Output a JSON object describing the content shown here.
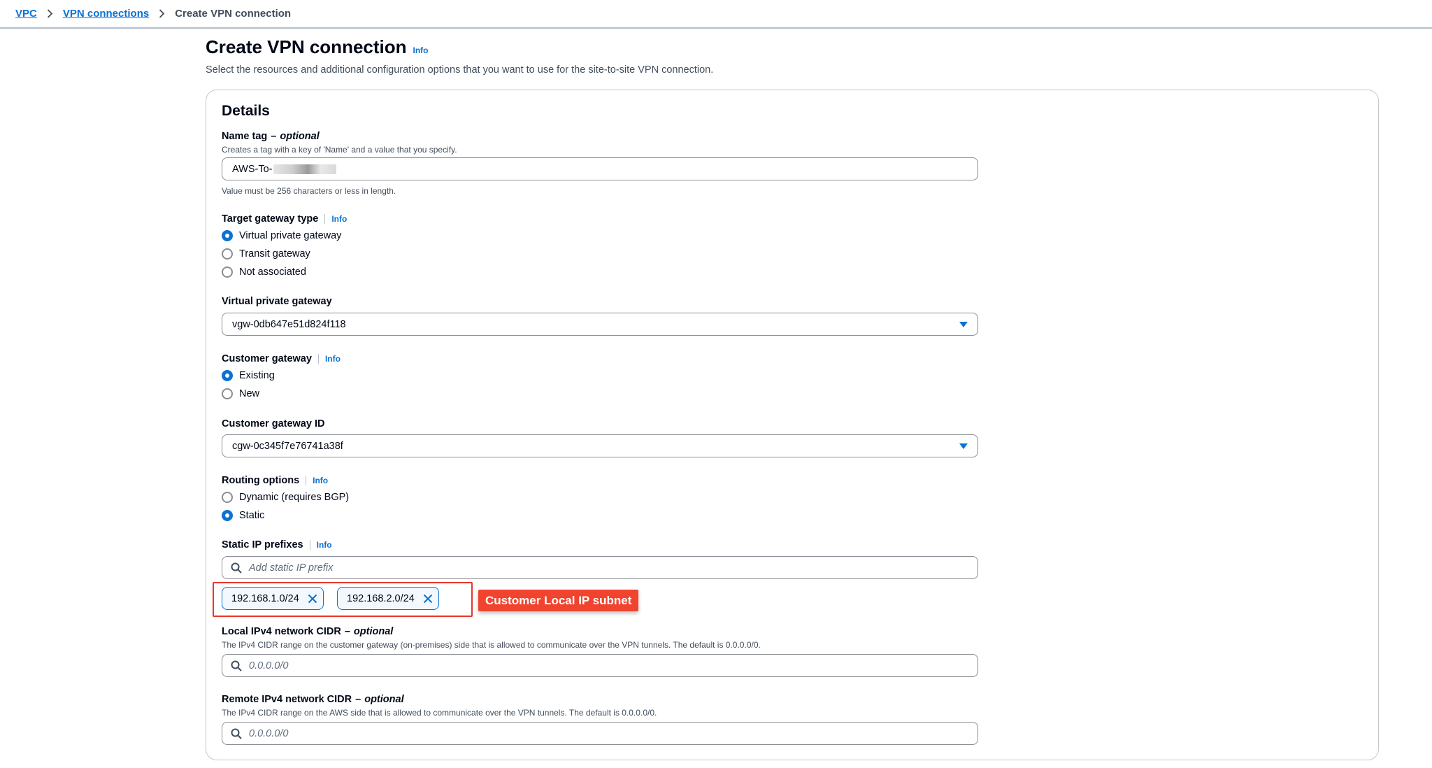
{
  "breadcrumb": {
    "items": [
      "VPC",
      "VPN connections"
    ],
    "current": "Create VPN connection"
  },
  "header": {
    "title": "Create VPN connection",
    "info": "Info",
    "description": "Select the resources and additional configuration options that you want to use for the site-to-site VPN connection."
  },
  "details": {
    "title": "Details",
    "name_tag": {
      "label": "Name tag",
      "optional": "optional",
      "description": "Creates a tag with a key of 'Name' and a value that you specify.",
      "value": "AWS-To-",
      "hint": "Value must be 256 characters or less in length."
    },
    "target_gateway_type": {
      "label": "Target gateway type",
      "info": "Info",
      "options": [
        "Virtual private gateway",
        "Transit gateway",
        "Not associated"
      ],
      "selected": "Virtual private gateway"
    },
    "virtual_private_gateway": {
      "label": "Virtual private gateway",
      "value": "vgw-0db647e51d824f118"
    },
    "customer_gateway": {
      "label": "Customer gateway",
      "info": "Info",
      "options": [
        "Existing",
        "New"
      ],
      "selected": "Existing"
    },
    "customer_gateway_id": {
      "label": "Customer gateway ID",
      "value": "cgw-0c345f7e76741a38f"
    },
    "routing_options": {
      "label": "Routing options",
      "info": "Info",
      "options": [
        "Dynamic (requires BGP)",
        "Static"
      ],
      "selected": "Static"
    },
    "static_ip_prefixes": {
      "label": "Static IP prefixes",
      "info": "Info",
      "placeholder": "Add static IP prefix",
      "tokens": [
        "192.168.1.0/24",
        "192.168.2.0/24"
      ],
      "annotation": "Customer Local IP subnet"
    },
    "local_ipv4_cidr": {
      "label": "Local IPv4 network CIDR",
      "optional": "optional",
      "description": "The IPv4 CIDR range on the customer gateway (on-premises) side that is allowed to communicate over the VPN tunnels. The default is 0.0.0.0/0.",
      "placeholder": "0.0.0.0/0"
    },
    "remote_ipv4_cidr": {
      "label": "Remote IPv4 network CIDR",
      "optional": "optional",
      "description": "The IPv4 CIDR range on the AWS side that is allowed to communicate over the VPN tunnels. The default is 0.0.0.0/0.",
      "placeholder": "0.0.0.0/0"
    }
  },
  "colors": {
    "link": "#0972d3",
    "annotation": "#f0442f",
    "highlight_border": "#e8362b"
  }
}
